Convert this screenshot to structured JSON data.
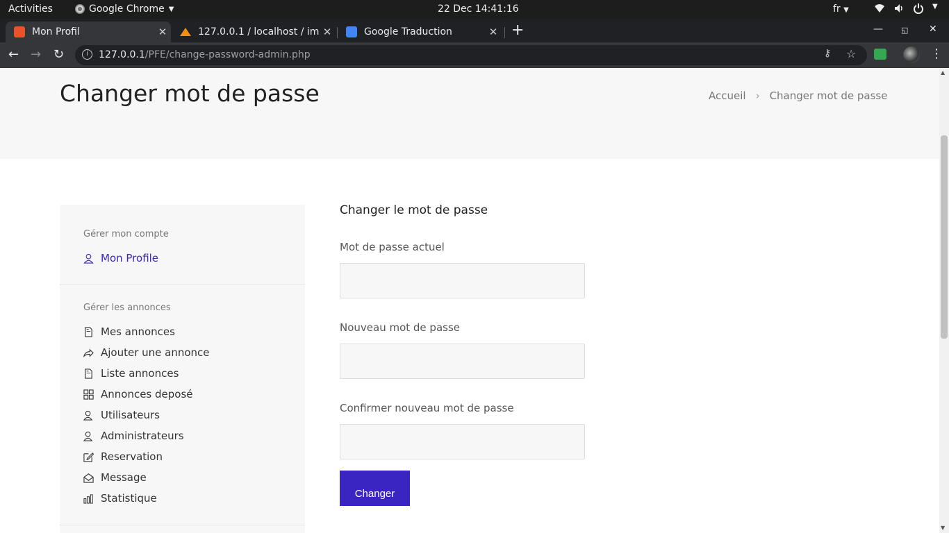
{
  "system": {
    "activities": "Activities",
    "app": "Google Chrome",
    "clock": "22 Dec  14:41:16",
    "lang": "fr"
  },
  "browser": {
    "tabs": [
      {
        "title": "Mon Profil",
        "favicon_color": "#e8542a"
      },
      {
        "title": "127.0.0.1 / localhost / imm",
        "favicon_color": "#f29111"
      },
      {
        "title": "Google Traduction",
        "favicon_color": "#4285f4"
      }
    ],
    "url_host": "127.0.0.1",
    "url_path": "/PFE/change-password-admin.php"
  },
  "header": {
    "title": "Changer mot de passe",
    "breadcrumb": [
      "Accueil",
      "Changer mot de passe"
    ]
  },
  "sidebar": {
    "sections": [
      {
        "title": "Gérer mon compte",
        "items": [
          {
            "label": "Mon Profile",
            "icon": "user-icon"
          }
        ]
      },
      {
        "title": "Gérer les annonces",
        "items": [
          {
            "label": "Mes annonces",
            "icon": "file-icon"
          },
          {
            "label": "Ajouter une annonce",
            "icon": "share-icon"
          },
          {
            "label": "Liste annonces",
            "icon": "file-icon"
          },
          {
            "label": "Annonces deposé",
            "icon": "grid-icon"
          },
          {
            "label": "Utilisateurs",
            "icon": "users-icon"
          },
          {
            "label": "Administrateurs",
            "icon": "users-icon"
          },
          {
            "label": "Reservation",
            "icon": "edit-icon"
          },
          {
            "label": "Message",
            "icon": "envelope-icon"
          },
          {
            "label": "Statistique",
            "icon": "bar-chart-icon"
          }
        ]
      }
    ]
  },
  "form": {
    "heading": "Changer le mot de passe",
    "current_label": "Mot de passe actuel",
    "new_label": "Nouveau mot de passe",
    "confirm_label": "Confirmer nouveau mot de passe",
    "submit": "Changer"
  },
  "colors": {
    "accent": "#3b25c2"
  }
}
